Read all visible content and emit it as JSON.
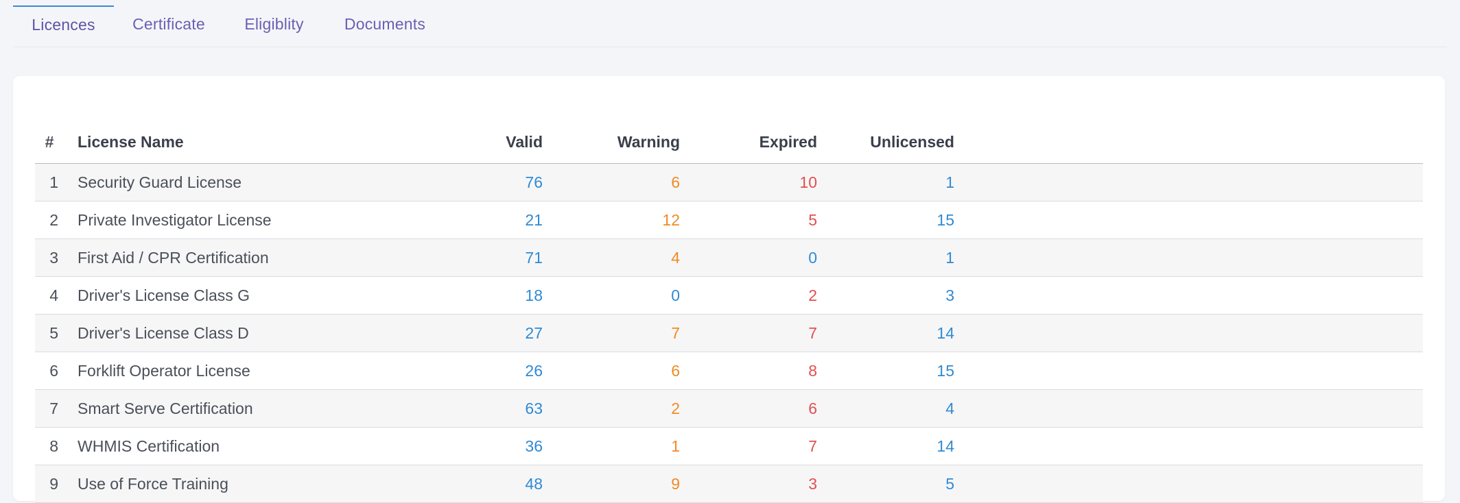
{
  "tabs": [
    {
      "label": "Licences",
      "active": true
    },
    {
      "label": "Certificate",
      "active": false
    },
    {
      "label": "Eligiblity",
      "active": false
    },
    {
      "label": "Documents",
      "active": false
    }
  ],
  "table": {
    "headers": {
      "index": "#",
      "name": "License Name",
      "valid": "Valid",
      "warning": "Warning",
      "expired": "Expired",
      "unlicensed": "Unlicensed"
    },
    "rows": [
      {
        "index": "1",
        "name": "Security Guard License",
        "valid": "76",
        "warning": "6",
        "expired": "10",
        "unlicensed": "1"
      },
      {
        "index": "2",
        "name": "Private Investigator License",
        "valid": "21",
        "warning": "12",
        "expired": "5",
        "unlicensed": "15"
      },
      {
        "index": "3",
        "name": "First Aid / CPR Certification",
        "valid": "71",
        "warning": "4",
        "expired": "0",
        "unlicensed": "1"
      },
      {
        "index": "4",
        "name": "Driver's License Class G",
        "valid": "18",
        "warning": "0",
        "expired": "2",
        "unlicensed": "3"
      },
      {
        "index": "5",
        "name": "Driver's License Class D",
        "valid": "27",
        "warning": "7",
        "expired": "7",
        "unlicensed": "14"
      },
      {
        "index": "6",
        "name": "Forklift Operator License",
        "valid": "26",
        "warning": "6",
        "expired": "8",
        "unlicensed": "15"
      },
      {
        "index": "7",
        "name": "Smart Serve Certification",
        "valid": "63",
        "warning": "2",
        "expired": "6",
        "unlicensed": "4"
      },
      {
        "index": "8",
        "name": "WHMIS Certification",
        "valid": "36",
        "warning": "1",
        "expired": "7",
        "unlicensed": "14"
      },
      {
        "index": "9",
        "name": "Use of Force Training",
        "valid": "48",
        "warning": "9",
        "expired": "3",
        "unlicensed": "5"
      }
    ]
  },
  "colors": {
    "valid": "#2f8ad3",
    "warning": "#f08a24",
    "expired": "#e34f4f",
    "unlicensed": "#2f8ad3",
    "zero": "#2f8ad3",
    "tab_text": "#6a5fb3",
    "tab_active_indicator": "#3f86d6"
  }
}
